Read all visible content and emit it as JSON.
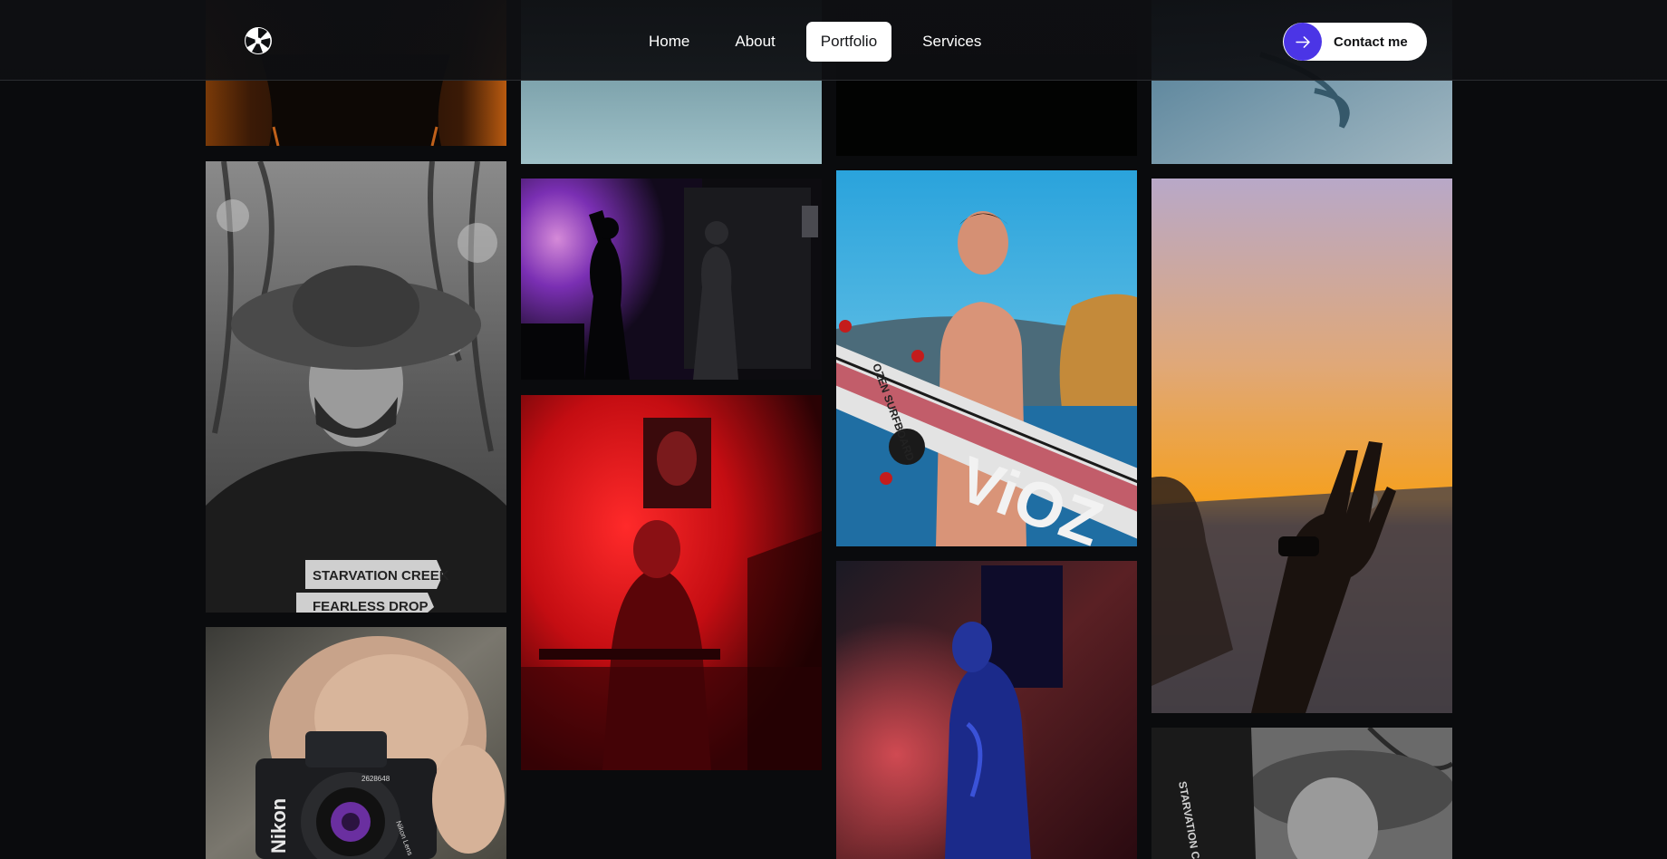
{
  "nav": {
    "items": [
      {
        "label": "Home"
      },
      {
        "label": "About"
      },
      {
        "label": "Portfolio"
      },
      {
        "label": "Services"
      }
    ],
    "active": "Portfolio"
  },
  "contact": {
    "label": "Contact me"
  },
  "colors": {
    "accent": "#4b35e6",
    "background": "#0a0b0d",
    "header": "#0e0f12"
  },
  "icons": {
    "logo": "aperture-icon",
    "contact": "arrow-right-icon"
  },
  "photo_text": {
    "shirt_line_1": "STARVATION CREEK",
    "shirt_line_2": "FEARLESS DROP",
    "board_text": "OZEN SURFBOARD",
    "board_brand": "ViOZ",
    "camera_brand": "Nikon",
    "lens_text": "Nikon Lens",
    "lens_number": "2628648",
    "shirt_line_3": "STARVATION CREEK"
  }
}
